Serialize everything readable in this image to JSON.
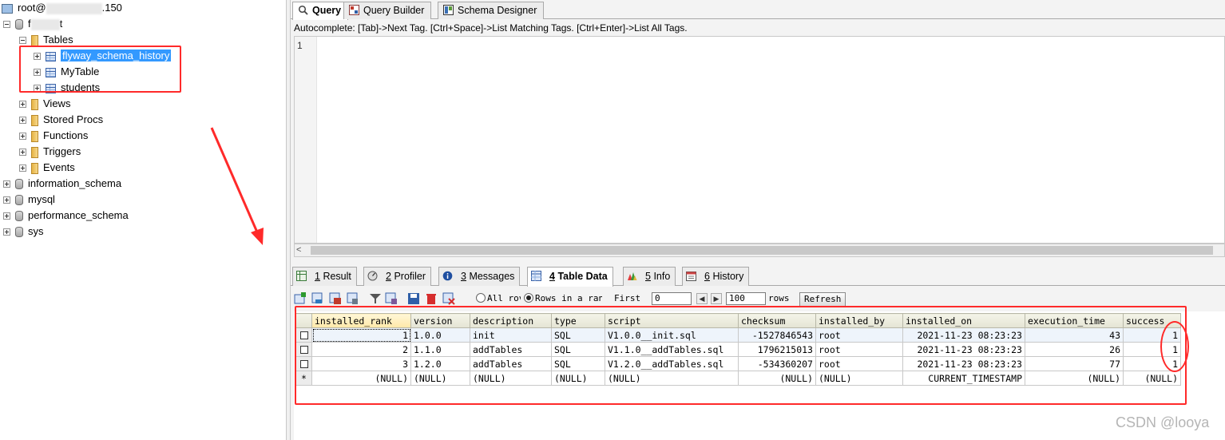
{
  "tree": {
    "server_prefix": "root@",
    "server_suffix": ".150",
    "db_prefix": "f",
    "db_suffix": "t",
    "tables_label": "Tables",
    "tables": [
      "flyway_schema_history",
      "MyTable",
      "students"
    ],
    "views_label": "Views",
    "procs_label": "Stored Procs",
    "functions_label": "Functions",
    "triggers_label": "Triggers",
    "events_label": "Events",
    "databases": [
      "information_schema",
      "mysql",
      "performance_schema",
      "sys"
    ]
  },
  "query_tabs": [
    "Query",
    "Query Builder",
    "Schema Designer"
  ],
  "autocomplete": "Autocomplete: [Tab]->Next Tag. [Ctrl+Space]->List Matching Tags. [Ctrl+Enter]->List All Tags.",
  "editor": {
    "line_number": "1"
  },
  "result_tabs": [
    {
      "num": "1",
      "label": "Result"
    },
    {
      "num": "2",
      "label": "Profiler"
    },
    {
      "num": "3",
      "label": "Messages"
    },
    {
      "num": "4",
      "label": "Table Data"
    },
    {
      "num": "5",
      "label": "Info"
    },
    {
      "num": "6",
      "label": "History"
    }
  ],
  "toolbar": {
    "all_rows": "All rov",
    "rows_in_range": "Rows in a rang",
    "first_label": "First",
    "first_value": "0",
    "rows_value": "100",
    "rows_label": "rows",
    "refresh": "Refresh"
  },
  "grid": {
    "columns": [
      "installed_rank",
      "version",
      "description",
      "type",
      "script",
      "checksum",
      "installed_by",
      "installed_on",
      "execution_time",
      "success"
    ],
    "rows": [
      [
        "1",
        "1.0.0",
        "init",
        "SQL",
        "V1.0.0__init.sql",
        "-1527846543",
        "root",
        "2021-11-23 08:23:23",
        "43",
        "1"
      ],
      [
        "2",
        "1.1.0",
        "addTables",
        "SQL",
        "V1.1.0__addTables.sql",
        "1796215013",
        "root",
        "2021-11-23 08:23:23",
        "26",
        "1"
      ],
      [
        "3",
        "1.2.0",
        "addTables",
        "SQL",
        "V1.2.0__addTables.sql",
        "-534360207",
        "root",
        "2021-11-23 08:23:23",
        "77",
        "1"
      ]
    ],
    "new_row": [
      "(NULL)",
      "(NULL)",
      "(NULL)",
      "(NULL)",
      "(NULL)",
      "(NULL)",
      "(NULL)",
      "CURRENT_TIMESTAMP",
      "(NULL)",
      "(NULL)"
    ],
    "new_row_marker": "*"
  },
  "watermark": "CSDN @looya",
  "colors": {
    "annotation": "#ff2a2a",
    "selection": "#3399ff"
  }
}
